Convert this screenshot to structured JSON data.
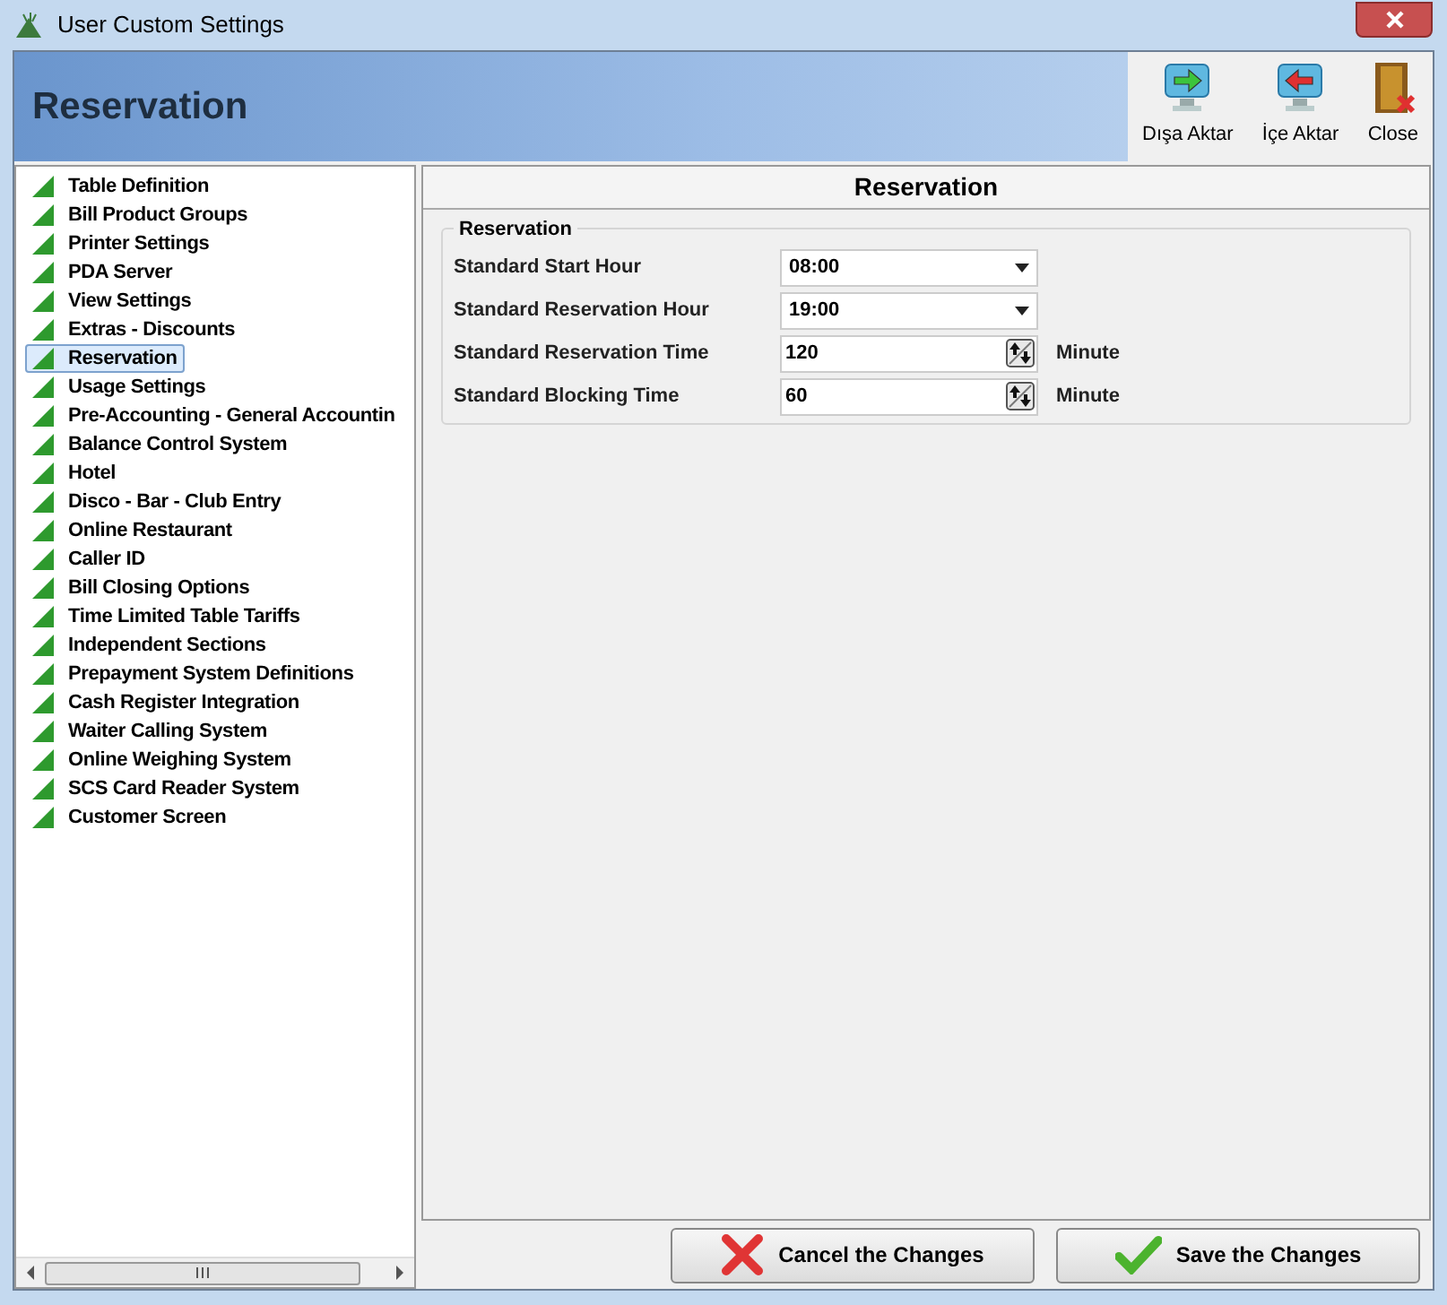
{
  "window": {
    "title": "User Custom Settings"
  },
  "header": {
    "title": "Reservation",
    "toolbar": [
      {
        "label": "Dışa Aktar",
        "kind": "export"
      },
      {
        "label": "İçe Aktar",
        "kind": "import"
      },
      {
        "label": "Close",
        "kind": "close"
      }
    ]
  },
  "sidebar": {
    "items": [
      {
        "label": "Table Definition",
        "selected": false
      },
      {
        "label": "Bill Product Groups",
        "selected": false
      },
      {
        "label": "Printer Settings",
        "selected": false
      },
      {
        "label": "PDA Server",
        "selected": false
      },
      {
        "label": "View Settings",
        "selected": false
      },
      {
        "label": "Extras - Discounts",
        "selected": false
      },
      {
        "label": "Reservation",
        "selected": true
      },
      {
        "label": "Usage Settings",
        "selected": false
      },
      {
        "label": "Pre-Accounting - General Accountin",
        "selected": false
      },
      {
        "label": "Balance Control System",
        "selected": false
      },
      {
        "label": "Hotel",
        "selected": false
      },
      {
        "label": "Disco - Bar - Club Entry",
        "selected": false
      },
      {
        "label": "Online Restaurant",
        "selected": false
      },
      {
        "label": "Caller ID",
        "selected": false
      },
      {
        "label": "Bill Closing Options",
        "selected": false
      },
      {
        "label": "Time Limited Table Tariffs",
        "selected": false
      },
      {
        "label": "Independent Sections",
        "selected": false
      },
      {
        "label": "Prepayment System Definitions",
        "selected": false
      },
      {
        "label": "Cash Register Integration",
        "selected": false
      },
      {
        "label": "Waiter Calling System",
        "selected": false
      },
      {
        "label": "Online Weighing System",
        "selected": false
      },
      {
        "label": "SCS Card Reader System",
        "selected": false
      },
      {
        "label": "Customer Screen",
        "selected": false
      }
    ]
  },
  "panel": {
    "title": "Reservation",
    "group": {
      "title": "Reservation",
      "fields": [
        {
          "label": "Standard Start Hour",
          "kind": "dropdown",
          "value": "08:00"
        },
        {
          "label": "Standard Reservation Hour",
          "kind": "dropdown",
          "value": "19:00"
        },
        {
          "label": "Standard Reservation Time",
          "kind": "spinner",
          "value": "120",
          "unit": "Minute"
        },
        {
          "label": "Standard Blocking Time",
          "kind": "spinner",
          "value": "60",
          "unit": "Minute"
        }
      ]
    }
  },
  "buttons": [
    {
      "label": "Cancel the Changes",
      "kind": "cancel"
    },
    {
      "label": "Save the Changes",
      "kind": "save"
    }
  ]
}
